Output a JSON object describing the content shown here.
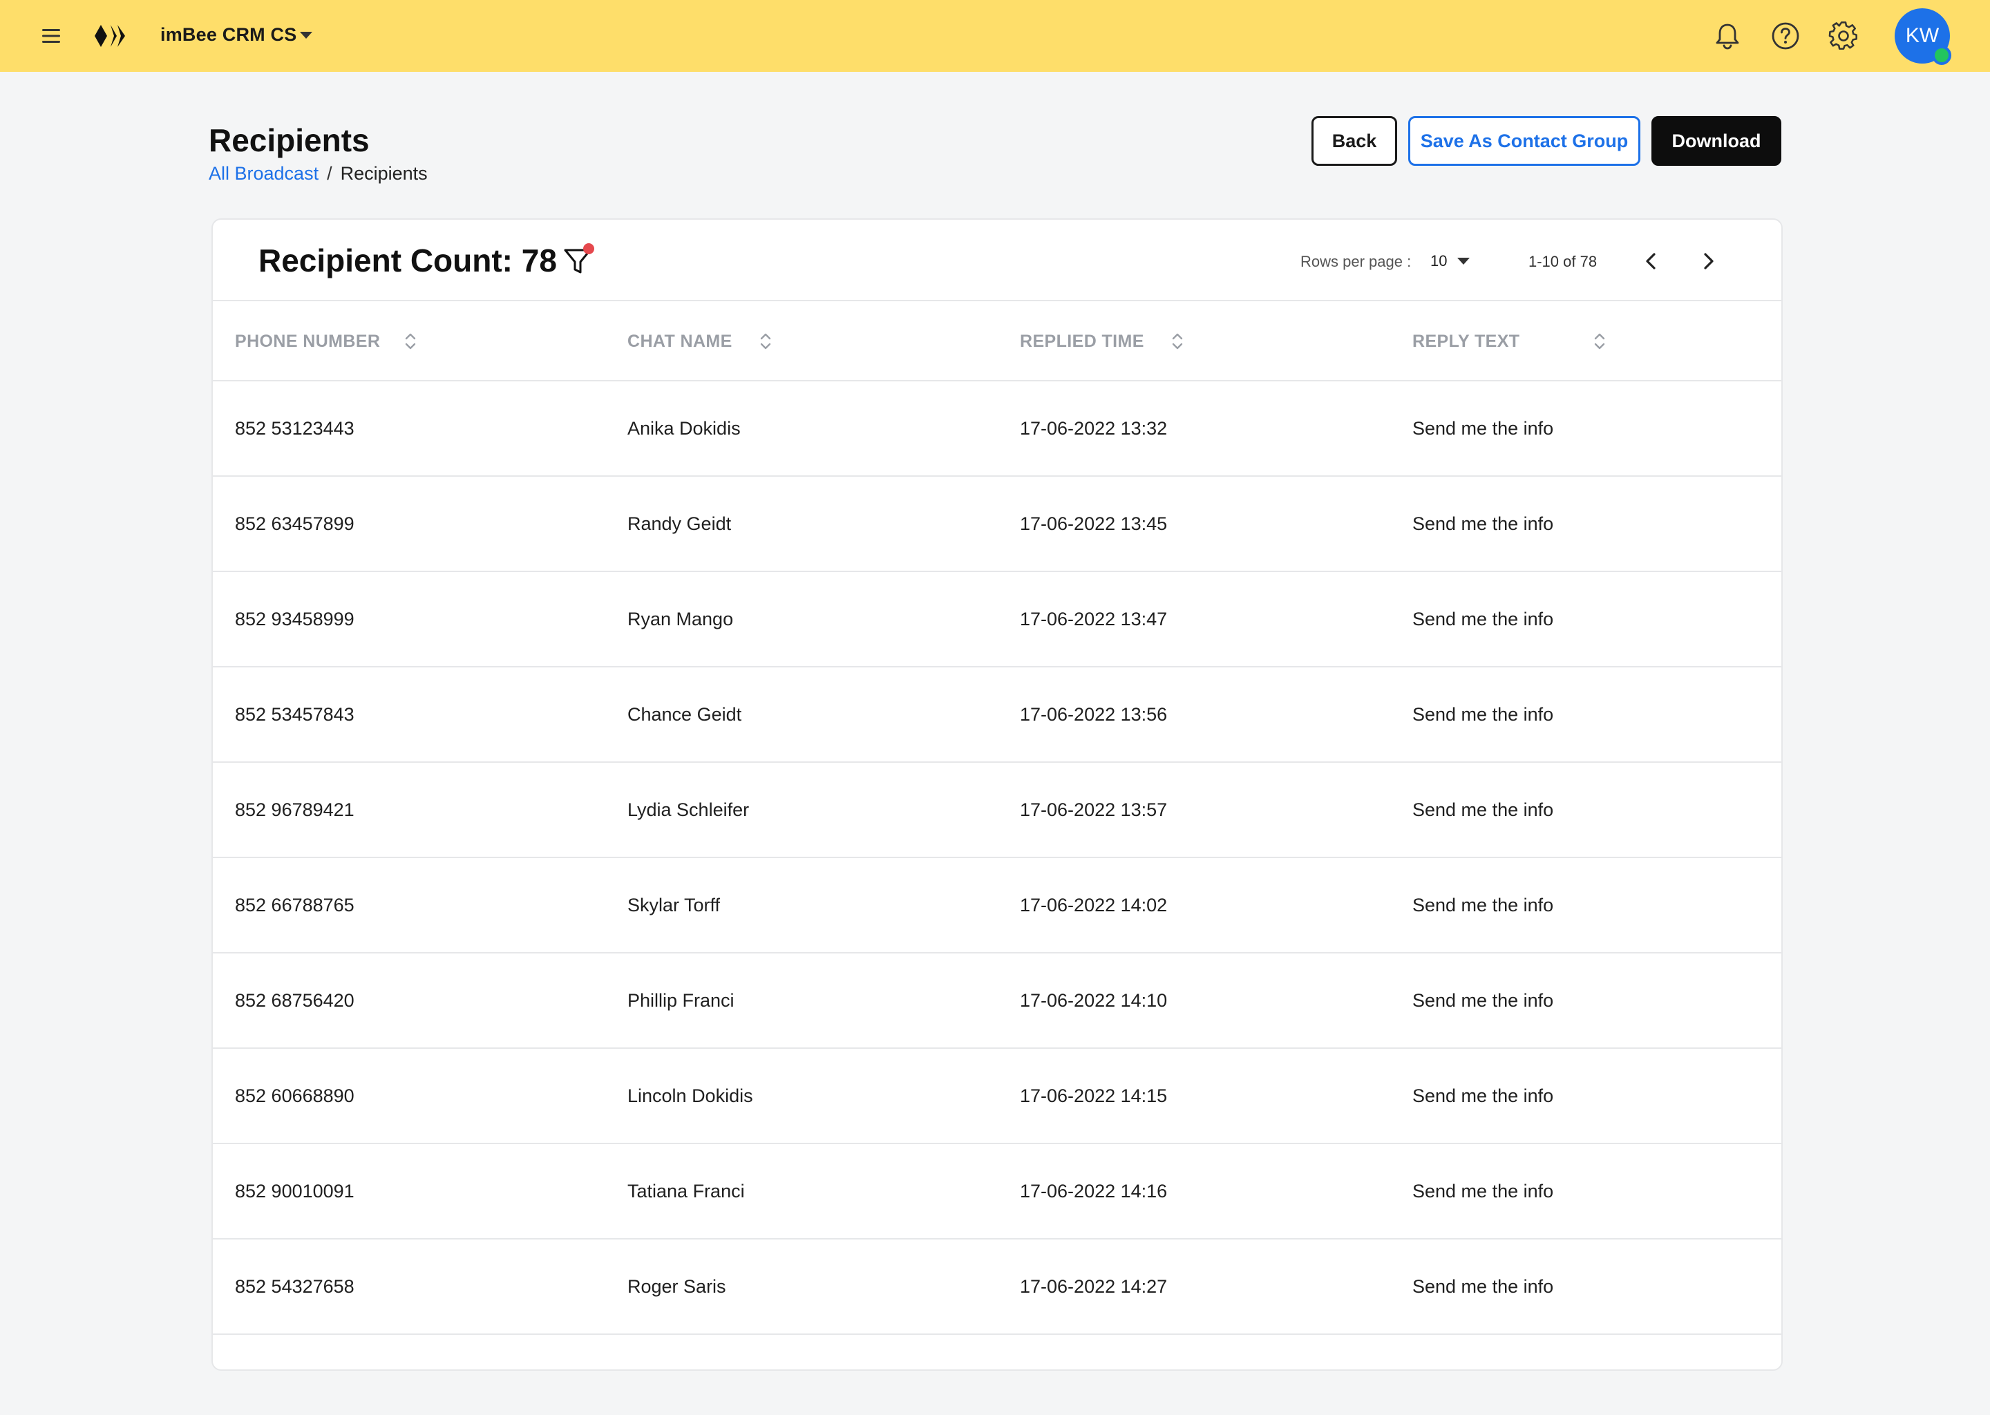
{
  "topbar": {
    "app_name": "imBee CRM CS",
    "user_initials": "KW",
    "icons": [
      "menu-icon",
      "brand-logo",
      "chevron-down-icon",
      "bell-icon",
      "help-icon",
      "gear-icon"
    ],
    "colors": {
      "bar": "#fede6a",
      "avatar": "#1d71e8",
      "presence": "#22c55e"
    }
  },
  "page": {
    "title": "Recipients",
    "breadcrumb": {
      "parent": "All Broadcast",
      "separator": "/",
      "current": "Recipients"
    },
    "actions": {
      "back": "Back",
      "save_group": "Save As Contact Group",
      "download": "Download"
    }
  },
  "card": {
    "count_title": "Recipient Count: 78",
    "rows_per_page_label": "Rows per page :",
    "rows_per_page_value": "10",
    "range_text": "1-10 of 78"
  },
  "table": {
    "headers": {
      "phone": "PHONE NUMBER",
      "chat_name": "CHAT NAME",
      "replied_time": "REPLIED TIME",
      "reply_text": "REPLY TEXT"
    },
    "rows": [
      {
        "phone": "852 53123443",
        "chat_name": "Anika Dokidis",
        "replied_time": "17-06-2022 13:32",
        "reply_text": "Send me the info"
      },
      {
        "phone": "852 63457899",
        "chat_name": "Randy Geidt",
        "replied_time": "17-06-2022 13:45",
        "reply_text": "Send me the info"
      },
      {
        "phone": "852 93458999",
        "chat_name": "Ryan Mango",
        "replied_time": "17-06-2022 13:47",
        "reply_text": "Send me the info"
      },
      {
        "phone": "852 53457843",
        "chat_name": "Chance Geidt",
        "replied_time": "17-06-2022 13:56",
        "reply_text": "Send me the info"
      },
      {
        "phone": "852 96789421",
        "chat_name": "Lydia Schleifer",
        "replied_time": "17-06-2022 13:57",
        "reply_text": "Send me the info"
      },
      {
        "phone": "852 66788765",
        "chat_name": "Skylar Torff",
        "replied_time": "17-06-2022 14:02",
        "reply_text": "Send me the info"
      },
      {
        "phone": "852 68756420",
        "chat_name": "Phillip Franci",
        "replied_time": "17-06-2022 14:10",
        "reply_text": "Send me the info"
      },
      {
        "phone": "852 60668890",
        "chat_name": "Lincoln Dokidis",
        "replied_time": "17-06-2022 14:15",
        "reply_text": "Send me the info"
      },
      {
        "phone": "852 90010091",
        "chat_name": "Tatiana Franci",
        "replied_time": "17-06-2022 14:16",
        "reply_text": "Send me the info"
      },
      {
        "phone": "852 54327658",
        "chat_name": "Roger Saris",
        "replied_time": "17-06-2022 14:27",
        "reply_text": "Send me the info"
      }
    ]
  }
}
